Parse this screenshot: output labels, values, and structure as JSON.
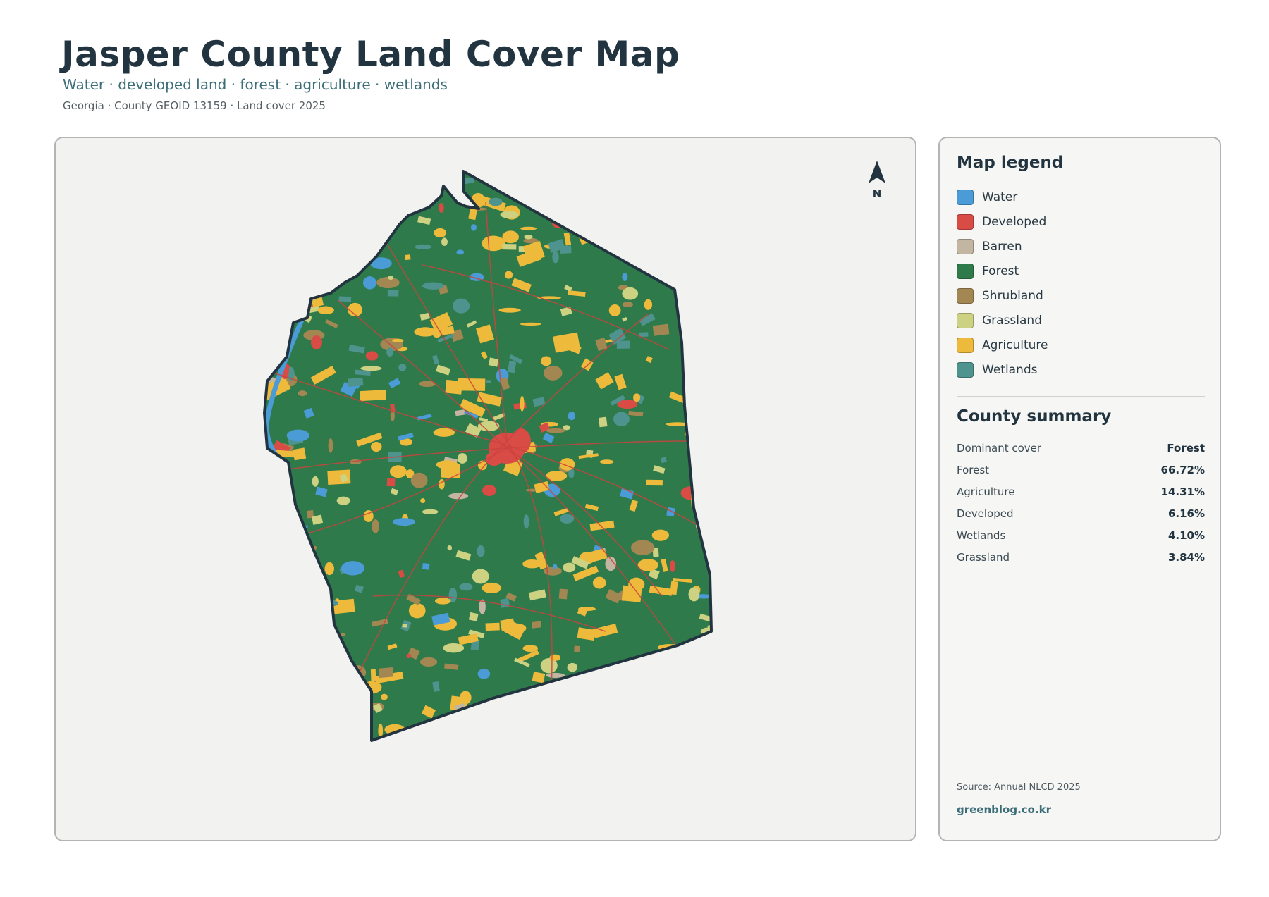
{
  "header": {
    "title": "Jasper County Land Cover Map",
    "subtitle": "Water · developed land · forest · agriculture · wetlands",
    "meta": "Georgia · County GEOID 13159 · Land cover 2025"
  },
  "map": {
    "north_label": "N",
    "colors": {
      "water": "#4a9bd6",
      "developed": "#d94b45",
      "barren": "#c2b5a2",
      "forest": "#2e7a4a",
      "shrubland": "#a38752",
      "grassland": "#cdd283",
      "agriculture": "#eeba3c",
      "wetlands": "#4f938e",
      "outline": "#22343f",
      "background": "#f2f2f1"
    }
  },
  "legend": {
    "title": "Map legend",
    "items": [
      {
        "label": "Water",
        "color": "#4a9bd6"
      },
      {
        "label": "Developed",
        "color": "#d94b45"
      },
      {
        "label": "Barren",
        "color": "#c2b5a2"
      },
      {
        "label": "Forest",
        "color": "#2e7a4a"
      },
      {
        "label": "Shrubland",
        "color": "#a38752"
      },
      {
        "label": "Grassland",
        "color": "#cdd283"
      },
      {
        "label": "Agriculture",
        "color": "#eeba3c"
      },
      {
        "label": "Wetlands",
        "color": "#4f938e"
      }
    ]
  },
  "summary": {
    "title": "County summary",
    "rows": [
      {
        "label": "Dominant cover",
        "value": "Forest"
      },
      {
        "label": "Forest",
        "value": "66.72%"
      },
      {
        "label": "Agriculture",
        "value": "14.31%"
      },
      {
        "label": "Developed",
        "value": "6.16%"
      },
      {
        "label": "Wetlands",
        "value": "4.10%"
      },
      {
        "label": "Grassland",
        "value": "3.84%"
      }
    ]
  },
  "footer": {
    "source": "Source: Annual NLCD 2025",
    "credit": "greenblog.co.kr"
  }
}
